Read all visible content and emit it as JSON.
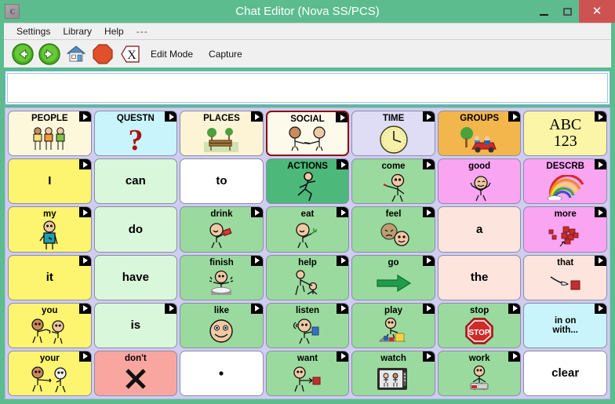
{
  "window": {
    "title": "Chat Editor (Nova SS/PCS)",
    "app_icon": "chat-app-icon",
    "controls": {
      "minimize": "minimize",
      "maximize": "maximize",
      "close": "close"
    },
    "close_color": "#cd5353",
    "chrome_color": "#5cbc8e"
  },
  "menubar": {
    "items": [
      "Settings",
      "Library",
      "Help",
      "---"
    ]
  },
  "toolbar": {
    "icons": [
      "back-arrow-icon",
      "forward-arrow-icon",
      "home-icon",
      "stop-icon",
      "clear-x-icon"
    ],
    "labels": [
      "Edit Mode",
      "Capture"
    ]
  },
  "message_bar": {
    "value": "",
    "placeholder": ""
  },
  "grid": {
    "rows": 6,
    "cols": 7,
    "background": "#cfcdf0",
    "selected_key": "SOCIAL",
    "keys": [
      {
        "label": "PEOPLE",
        "bg": "#fdf7dc",
        "icon": "three-people-icon",
        "arrow": true,
        "style": "cat"
      },
      {
        "label": "QUESTN",
        "bg": "#c9f4fb",
        "icon": "question-mark-icon",
        "arrow": true,
        "style": "cat"
      },
      {
        "label": "PLACES",
        "bg": "#fdf3d5",
        "icon": "park-bench-icon",
        "arrow": true,
        "style": "cat"
      },
      {
        "label": "SOCIAL",
        "bg": "#fdfaec",
        "icon": "handshake-icon",
        "arrow": true,
        "style": "cat",
        "selected": true
      },
      {
        "label": "TIME",
        "bg": "#dfdcf5",
        "icon": "clock-icon",
        "arrow": true,
        "style": "cat"
      },
      {
        "label": "GROUPS",
        "bg": "#f3b64d",
        "icon": "park-scene-icon",
        "arrow": true,
        "style": "cat"
      },
      {
        "label": "ABC 123",
        "bg": "#fbf5a8",
        "icon": "",
        "arrow": true,
        "style": "abc"
      },
      {
        "label": "I",
        "bg": "#fdf470",
        "icon": "",
        "arrow": true,
        "style": "word-big"
      },
      {
        "label": "can",
        "bg": "#d9f7da",
        "icon": "",
        "arrow": false,
        "style": "word-big"
      },
      {
        "label": "to",
        "bg": "#ffffff",
        "icon": "",
        "arrow": false,
        "style": "word-big"
      },
      {
        "label": "ACTIONS",
        "bg": "#4cb87a",
        "icon": "running-person-icon",
        "arrow": true,
        "style": "cat"
      },
      {
        "label": "come",
        "bg": "#9ada9e",
        "icon": "come-person-icon",
        "arrow": true,
        "style": "word"
      },
      {
        "label": "good",
        "bg": "#f9a5f2",
        "icon": "happy-person-icon",
        "arrow": false,
        "style": "word"
      },
      {
        "label": "DESCRB",
        "bg": "#f9a5f2",
        "icon": "rainbow-icon",
        "arrow": true,
        "style": "cat"
      },
      {
        "label": "my",
        "bg": "#fdf470",
        "icon": "my-person-icon",
        "arrow": true,
        "style": "word"
      },
      {
        "label": "do",
        "bg": "#d9f7da",
        "icon": "",
        "arrow": false,
        "style": "word-big"
      },
      {
        "label": "drink",
        "bg": "#9ada9e",
        "icon": "drink-icon",
        "arrow": true,
        "style": "word"
      },
      {
        "label": "eat",
        "bg": "#9ada9e",
        "icon": "eat-icon",
        "arrow": true,
        "style": "word"
      },
      {
        "label": "feel",
        "bg": "#9ada9e",
        "icon": "two-faces-icon",
        "arrow": true,
        "style": "word"
      },
      {
        "label": "a",
        "bg": "#fde4dd",
        "icon": "",
        "arrow": false,
        "style": "word-big"
      },
      {
        "label": "more",
        "bg": "#f9a5f2",
        "icon": "blocks-icon",
        "arrow": true,
        "style": "word"
      },
      {
        "label": "it",
        "bg": "#fdf470",
        "icon": "",
        "arrow": true,
        "style": "word-big"
      },
      {
        "label": "have",
        "bg": "#d9f7da",
        "icon": "",
        "arrow": false,
        "style": "word-big"
      },
      {
        "label": "finish",
        "bg": "#9ada9e",
        "icon": "finish-plate-icon",
        "arrow": true,
        "style": "word"
      },
      {
        "label": "help",
        "bg": "#9ada9e",
        "icon": "help-icon",
        "arrow": true,
        "style": "word"
      },
      {
        "label": "go",
        "bg": "#9ada9e",
        "icon": "green-arrow-icon",
        "arrow": true,
        "style": "word"
      },
      {
        "label": "the",
        "bg": "#fde4dd",
        "icon": "",
        "arrow": false,
        "style": "word-big"
      },
      {
        "label": "that",
        "bg": "#fde4dd",
        "icon": "pointing-hand-icon",
        "arrow": true,
        "style": "word"
      },
      {
        "label": "you",
        "bg": "#fdf470",
        "icon": "you-people-icon",
        "arrow": true,
        "style": "word"
      },
      {
        "label": "is",
        "bg": "#d9f7da",
        "icon": "",
        "arrow": true,
        "style": "word-big"
      },
      {
        "label": "like",
        "bg": "#9ada9e",
        "icon": "smiley-face-icon",
        "arrow": true,
        "style": "word"
      },
      {
        "label": "listen",
        "bg": "#9ada9e",
        "icon": "listen-icon",
        "arrow": true,
        "style": "word"
      },
      {
        "label": "play",
        "bg": "#9ada9e",
        "icon": "play-blocks-icon",
        "arrow": true,
        "style": "word"
      },
      {
        "label": "stop",
        "bg": "#9ada9e",
        "icon": "stop-sign-icon",
        "arrow": true,
        "style": "word"
      },
      {
        "label": "in on with...",
        "bg": "#c9f4fb",
        "icon": "",
        "arrow": true,
        "style": "two-line"
      },
      {
        "label": "your",
        "bg": "#fdf470",
        "icon": "your-people-icon",
        "arrow": true,
        "style": "word"
      },
      {
        "label": "don't",
        "bg": "#faa6a0",
        "icon": "black-x-icon",
        "arrow": false,
        "style": "word"
      },
      {
        "label": ".",
        "bg": "#ffffff",
        "icon": "period-dot-icon",
        "arrow": false,
        "style": "dot"
      },
      {
        "label": "want",
        "bg": "#9ada9e",
        "icon": "want-icon",
        "arrow": true,
        "style": "word"
      },
      {
        "label": "watch",
        "bg": "#9ada9e",
        "icon": "tv-icon",
        "arrow": true,
        "style": "word"
      },
      {
        "label": "work",
        "bg": "#9ada9e",
        "icon": "work-icon",
        "arrow": true,
        "style": "word"
      },
      {
        "label": "clear",
        "bg": "#ffffff",
        "icon": "",
        "arrow": false,
        "style": "word-big"
      }
    ]
  }
}
